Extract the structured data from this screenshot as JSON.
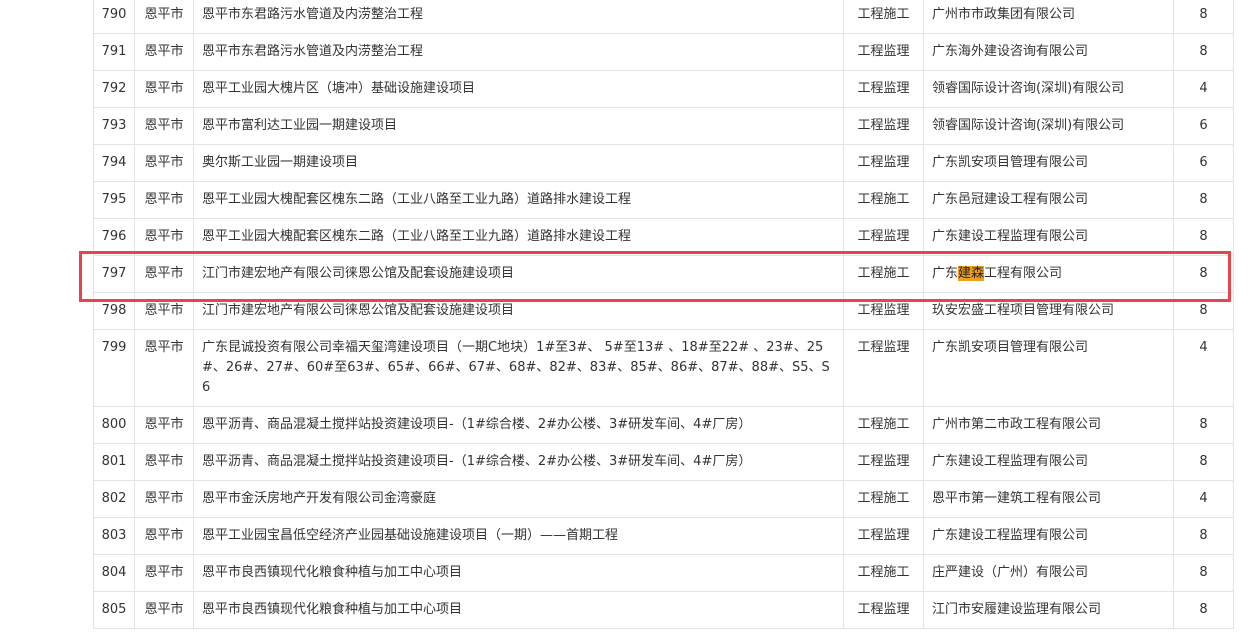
{
  "rows": [
    {
      "no": "790",
      "city": "恩平市",
      "project": "恩平市东君路污水管道及内涝整治工程",
      "type": "工程施工",
      "company": "广州市市政集团有限公司",
      "score": "8"
    },
    {
      "no": "791",
      "city": "恩平市",
      "project": "恩平市东君路污水管道及内涝整治工程",
      "type": "工程监理",
      "company": "广东海外建设咨询有限公司",
      "score": "8"
    },
    {
      "no": "792",
      "city": "恩平市",
      "project": "恩平工业园大槐片区（塘冲）基础设施建设项目",
      "type": "工程监理",
      "company": "领睿国际设计咨询(深圳)有限公司",
      "score": "4"
    },
    {
      "no": "793",
      "city": "恩平市",
      "project": "恩平市富利达工业园一期建设项目",
      "type": "工程监理",
      "company": "领睿国际设计咨询(深圳)有限公司",
      "score": "6"
    },
    {
      "no": "794",
      "city": "恩平市",
      "project": "奥尔斯工业园一期建设项目",
      "type": "工程监理",
      "company": "广东凯安项目管理有限公司",
      "score": "6"
    },
    {
      "no": "795",
      "city": "恩平市",
      "project": "恩平工业园大槐配套区槐东二路（工业八路至工业九路）道路排水建设工程",
      "type": "工程施工",
      "company": "广东邑冠建设工程有限公司",
      "score": "8"
    },
    {
      "no": "796",
      "city": "恩平市",
      "project": "恩平工业园大槐配套区槐东二路（工业八路至工业九路）道路排水建设工程",
      "type": "工程监理",
      "company": "广东建设工程监理有限公司",
      "score": "8"
    },
    {
      "no": "797",
      "city": "恩平市",
      "project": "江门市建宏地产有限公司徕恩公馆及配套设施建设项目",
      "type": "工程施工",
      "company_pre": "广东",
      "company_hl": "建森",
      "company_post": "工程有限公司",
      "score": "8"
    },
    {
      "no": "798",
      "city": "恩平市",
      "project": "江门市建宏地产有限公司徕恩公馆及配套设施建设项目",
      "type": "工程监理",
      "company": "玖安宏盛工程项目管理有限公司",
      "score": "8"
    },
    {
      "no": "799",
      "city": "恩平市",
      "project": "广东昆诚投资有限公司幸福天玺湾建设项目（一期C地块）1#至3#、 5#至13# 、18#至22# 、23#、25#、26#、27#、60#至63#、65#、66#、67#、68#、82#、83#、85#、86#、87#、88#、S5、S6",
      "type": "工程监理",
      "company": "广东凯安项目管理有限公司",
      "score": "4"
    },
    {
      "no": "800",
      "city": "恩平市",
      "project": "恩平沥青、商品混凝土搅拌站投资建设项目-（1#综合楼、2#办公楼、3#研发车间、4#厂房）",
      "type": "工程施工",
      "company": "广州市第二市政工程有限公司",
      "score": "8"
    },
    {
      "no": "801",
      "city": "恩平市",
      "project": "恩平沥青、商品混凝土搅拌站投资建设项目-（1#综合楼、2#办公楼、3#研发车间、4#厂房）",
      "type": "工程监理",
      "company": "广东建设工程监理有限公司",
      "score": "8"
    },
    {
      "no": "802",
      "city": "恩平市",
      "project": "恩平市金沃房地产开发有限公司金湾豪庭",
      "type": "工程施工",
      "company": "恩平市第一建筑工程有限公司",
      "score": "4"
    },
    {
      "no": "803",
      "city": "恩平市",
      "project": "恩平工业园宝昌低空经济产业园基础设施建设项目（一期）——首期工程",
      "type": "工程监理",
      "company": "广东建设工程监理有限公司",
      "score": "8"
    },
    {
      "no": "804",
      "city": "恩平市",
      "project": "恩平市良西镇现代化粮食种植与加工中心项目",
      "type": "工程施工",
      "company": "庄严建设（广州）有限公司",
      "score": "8"
    },
    {
      "no": "805",
      "city": "恩平市",
      "project": "恩平市良西镇现代化粮食种植与加工中心项目",
      "type": "工程监理",
      "company": "江门市安履建设监理有限公司",
      "score": "8"
    }
  ],
  "highlight_color": "#e8454b",
  "search_highlight_color": "#f0a020"
}
